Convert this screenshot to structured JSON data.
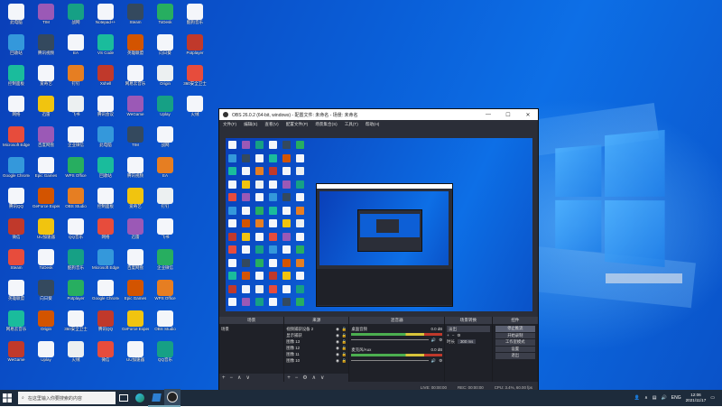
{
  "obs": {
    "title": "OBS 26.0.2 (64-bit, windows) - 配置文件: 未命名 - 场景: 未命名",
    "menu": [
      "文件(F)",
      "编辑(E)",
      "查看(V)",
      "配置文件(P)",
      "场景集合(S)",
      "工具(T)",
      "帮助(H)"
    ],
    "docks": {
      "scenes": {
        "title": "场景",
        "items": [
          "场景"
        ]
      },
      "sources": {
        "title": "来源",
        "items": [
          "视频捕获设备 2",
          "显示捕获",
          "图像 13",
          "图像 12",
          "图像 11",
          "图像 10"
        ]
      },
      "mixer": {
        "title": "混音器",
        "tracks": [
          {
            "name": "桌面音频",
            "db": "0.0 dB"
          },
          {
            "name": "麦克风/Aux",
            "db": "0.0 dB"
          }
        ]
      },
      "transitions": {
        "title": "场景转换",
        "type": "淡出",
        "duration_label": "时长",
        "duration_value": "300 ms"
      },
      "controls": {
        "title": "控件",
        "buttons": [
          "停止推流",
          "开始录制",
          "工作室模式",
          "设置",
          "退出"
        ]
      }
    },
    "status": {
      "live": "LIVE: 00:00:00",
      "rec": "REC: 00:00:00",
      "cpu": "CPU: 3.4%, 60.00 fps"
    }
  },
  "desktop": {
    "icons": [
      "此电脑",
      "回收站",
      "控制面板",
      "网络",
      "Microsoft Edge",
      "Google Chrome",
      "腾讯QQ",
      "微信",
      "Steam",
      "英雄联盟",
      "网易云音乐",
      "WeGame",
      "TIM",
      "腾讯视频",
      "爱奇艺",
      "迅雷",
      "百度网盘",
      "Epic Games",
      "GeForce Experience",
      "UU加速器",
      "ToDesk",
      "向日葵",
      "Origin",
      "Uplay",
      "战网",
      "EA",
      "钉钉",
      "飞书",
      "企业微信",
      "WPS Office",
      "OBS Studio",
      "QQ音乐",
      "酷狗音乐",
      "Potplayer",
      "360安全卫士",
      "火绒",
      "Notepad++",
      "VS Code",
      "Xshell",
      "腾讯会议"
    ]
  },
  "taskbar": {
    "search_placeholder": "在这里输入你要搜索的内容",
    "tray_lang": "ENG",
    "time": "12:06",
    "date": "2021/11/17"
  }
}
